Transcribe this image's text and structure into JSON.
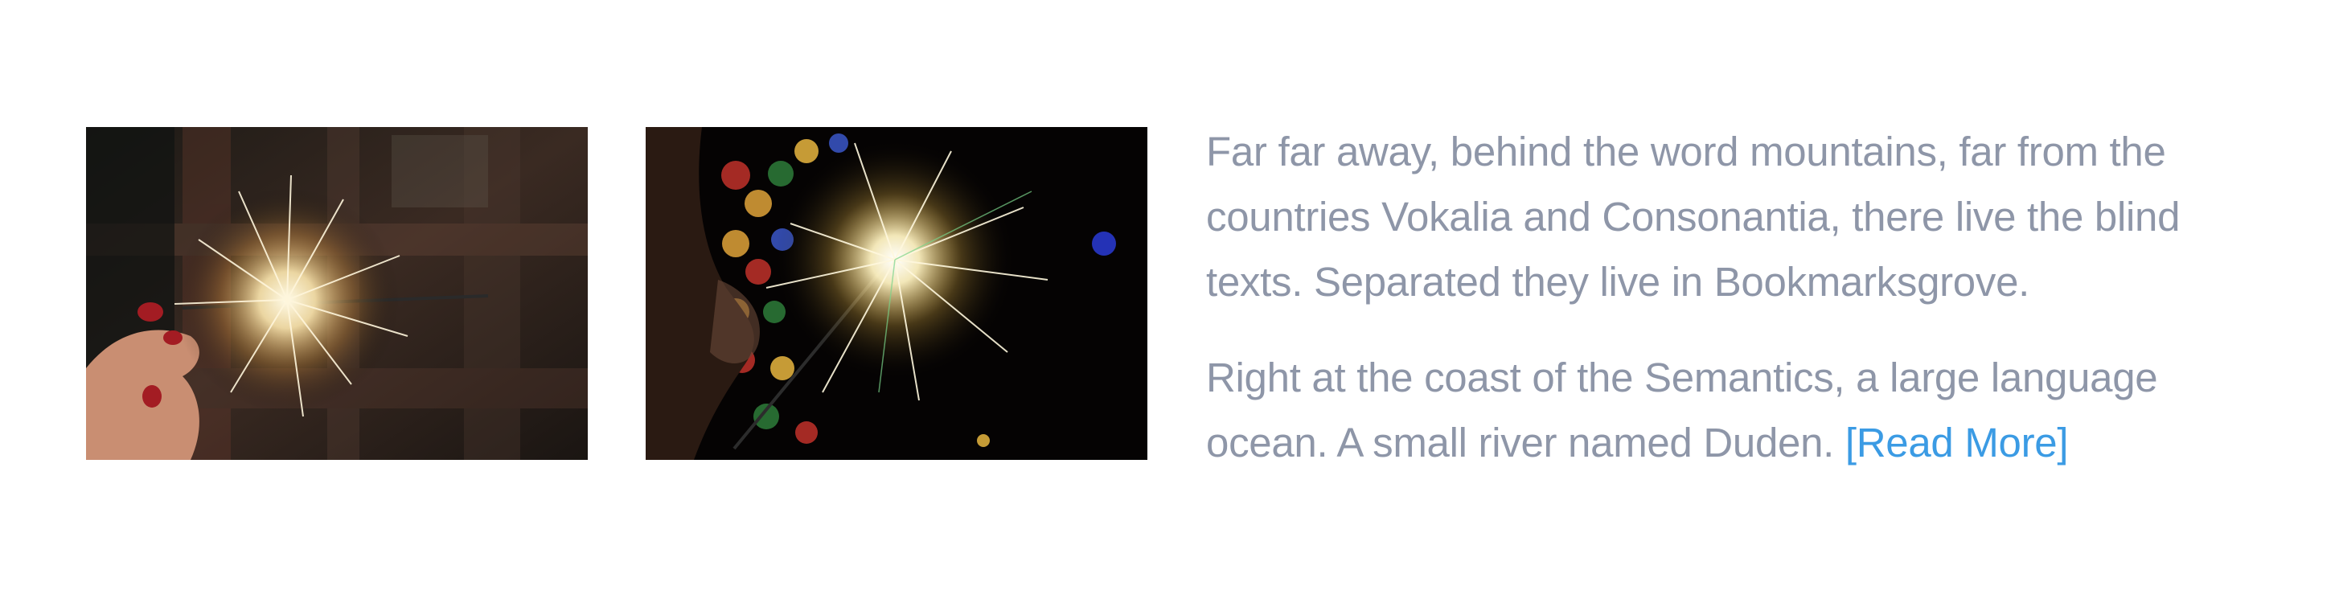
{
  "images": [
    {
      "name": "sparkler-hand-photo",
      "alt": ""
    },
    {
      "name": "sparkler-bokeh-photo",
      "alt": ""
    }
  ],
  "article": {
    "paragraph_1": "Far far away, behind the word mountains, far from the countries Vokalia and Consonantia, there live the blind texts. Separated they live in Bookmarksgrove.",
    "paragraph_2": "Right at the coast of the Semantics, a large language ocean. A small river named Duden.",
    "read_more_label": "[Read More]"
  },
  "colors": {
    "body_text": "#8e96a8",
    "link": "#3b9be4",
    "background": "#ffffff"
  }
}
